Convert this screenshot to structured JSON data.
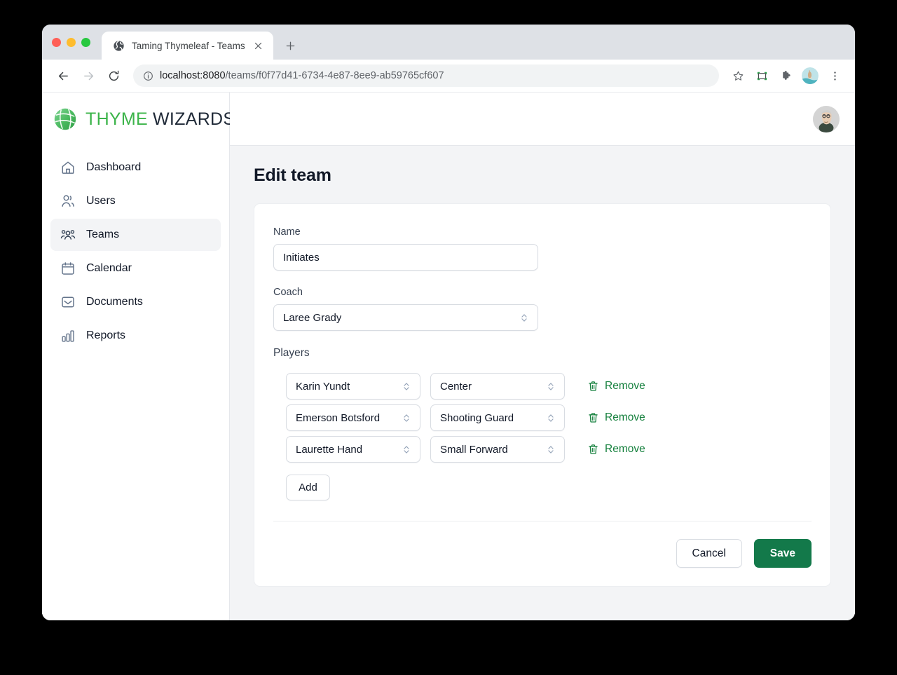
{
  "browser": {
    "tab": {
      "title": "Taming Thymeleaf - Teams",
      "favicon_icon": "globe-icon",
      "close_icon": "close-icon"
    },
    "new_tab_icon": "plus-icon",
    "back_icon": "arrow-left-icon",
    "forward_icon": "arrow-right-icon",
    "reload_icon": "reload-icon",
    "site_info_icon": "info-circle-icon",
    "url_host": "localhost:8080",
    "url_path": "/teams/f0f77d41-6734-4e87-8ee9-ab59765cf607",
    "url_full": "localhost:8080/teams/f0f77d41-6734-4e87-8ee9-ab59765cf607",
    "toolbar_icons": [
      "star-icon",
      "capture-icon",
      "extensions-puzzle-icon",
      "profile-avatar-icon",
      "more-vertical-icon"
    ]
  },
  "sidebar": {
    "logo": {
      "mark_icon": "basketball-leaf-logo-icon",
      "text_primary": "THYME",
      "text_secondary": "WIZARDS",
      "primary_color": "#3cb44a",
      "secondary_color": "#1f2937"
    },
    "items": [
      {
        "label": "Dashboard",
        "icon": "home-icon",
        "active": false
      },
      {
        "label": "Users",
        "icon": "users-icon",
        "active": false
      },
      {
        "label": "Teams",
        "icon": "team-group-icon",
        "active": true
      },
      {
        "label": "Calendar",
        "icon": "calendar-icon",
        "active": false
      },
      {
        "label": "Documents",
        "icon": "inbox-icon",
        "active": false
      },
      {
        "label": "Reports",
        "icon": "bar-chart-icon",
        "active": false
      }
    ]
  },
  "topbar": {
    "avatar_icon": "user-avatar"
  },
  "main": {
    "page_title": "Edit team",
    "form": {
      "name_label": "Name",
      "name_value": "Initiates",
      "coach_label": "Coach",
      "coach_value": "Laree Grady",
      "players_label": "Players",
      "players": [
        {
          "name": "Karin Yundt",
          "position": "Center",
          "remove_label": "Remove",
          "remove_icon": "trash-icon"
        },
        {
          "name": "Emerson Botsford",
          "position": "Shooting Guard",
          "remove_label": "Remove",
          "remove_icon": "trash-icon"
        },
        {
          "name": "Laurette Hand",
          "position": "Small Forward",
          "remove_label": "Remove",
          "remove_icon": "trash-icon"
        }
      ],
      "add_label": "Add",
      "cancel_label": "Cancel",
      "save_label": "Save"
    }
  },
  "colors": {
    "brand_green": "#3cb44a",
    "action_green": "#13794a",
    "link_green": "#15803d",
    "page_bg": "#f3f4f6"
  }
}
